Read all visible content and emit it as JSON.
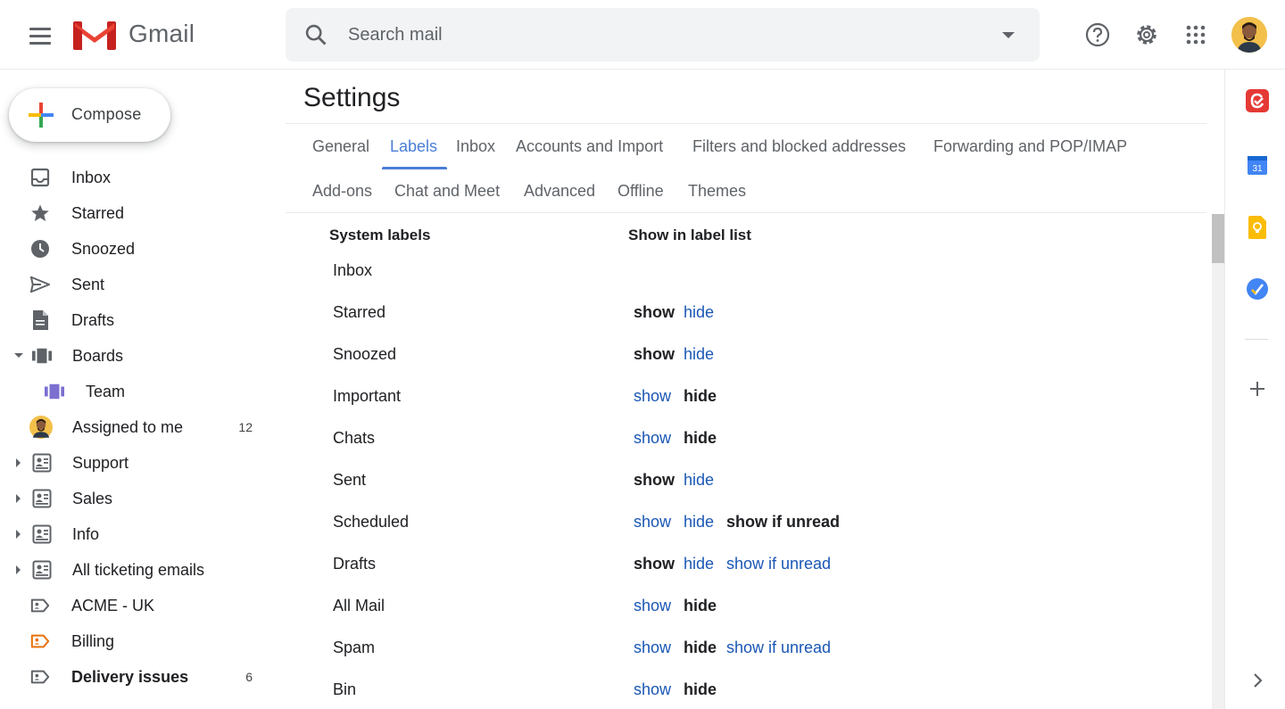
{
  "app": {
    "name": "Gmail"
  },
  "search": {
    "placeholder": "Search mail"
  },
  "header_icons": [
    "help-icon",
    "settings-icon",
    "apps-grid-icon",
    "account-avatar"
  ],
  "compose": {
    "label": "Compose"
  },
  "nav": {
    "items": [
      {
        "label": "Inbox",
        "icon": "inbox-icon",
        "count": ""
      },
      {
        "label": "Starred",
        "icon": "star-icon",
        "count": ""
      },
      {
        "label": "Snoozed",
        "icon": "clock-icon",
        "count": ""
      },
      {
        "label": "Sent",
        "icon": "send-icon",
        "count": ""
      },
      {
        "label": "Drafts",
        "icon": "draft-icon",
        "count": ""
      },
      {
        "label": "Boards",
        "icon": "boards-icon",
        "count": ""
      },
      {
        "label": "Team",
        "icon": "boards-icon",
        "count": ""
      },
      {
        "label": "Assigned to me",
        "icon": "avatar",
        "count": "12"
      },
      {
        "label": "Support",
        "icon": "contact-label-icon",
        "count": ""
      },
      {
        "label": "Sales",
        "icon": "contact-label-icon",
        "count": ""
      },
      {
        "label": "Info",
        "icon": "contact-label-icon",
        "count": ""
      },
      {
        "label": "All ticketing emails",
        "icon": "contact-label-icon",
        "count": ""
      },
      {
        "label": "ACME - UK",
        "icon": "label-icon",
        "count": ""
      },
      {
        "label": "Billing",
        "icon": "label-icon",
        "count": ""
      },
      {
        "label": "Delivery issues",
        "icon": "label-icon",
        "count": "6"
      }
    ]
  },
  "settings": {
    "title": "Settings",
    "tabs": [
      "General",
      "Labels",
      "Inbox",
      "Accounts and Import",
      "Filters and blocked addresses",
      "Forwarding and POP/IMAP",
      "Add-ons",
      "Chat and Meet",
      "Advanced",
      "Offline",
      "Themes"
    ],
    "active_tab": "Labels"
  },
  "labels_table": {
    "col_system": "System labels",
    "col_show": "Show in label list",
    "opt_show": "show",
    "opt_hide": "hide",
    "opt_unread": "show if unread",
    "rows": [
      {
        "name": "Inbox",
        "selected": ""
      },
      {
        "name": "Starred",
        "selected": "show"
      },
      {
        "name": "Snoozed",
        "selected": "show"
      },
      {
        "name": "Important",
        "selected": "hide"
      },
      {
        "name": "Chats",
        "selected": "hide"
      },
      {
        "name": "Sent",
        "selected": "show"
      },
      {
        "name": "Scheduled",
        "selected": "show if unread"
      },
      {
        "name": "Drafts",
        "selected": "show"
      },
      {
        "name": "All Mail",
        "selected": "hide"
      },
      {
        "name": "Spam",
        "selected": "hide"
      },
      {
        "name": "Bin",
        "selected": "hide"
      }
    ]
  },
  "side_panel": [
    "tasks-app-icon",
    "calendar-icon",
    "keep-icon",
    "tasks-icon",
    "add-icon",
    "expand-chevron-icon"
  ],
  "calendar_day": "31",
  "colors": {
    "accent": "#4a7ed6",
    "link": "#1a57b5",
    "billing_label": "#e8710a",
    "team_board": "#7b6fd0"
  }
}
